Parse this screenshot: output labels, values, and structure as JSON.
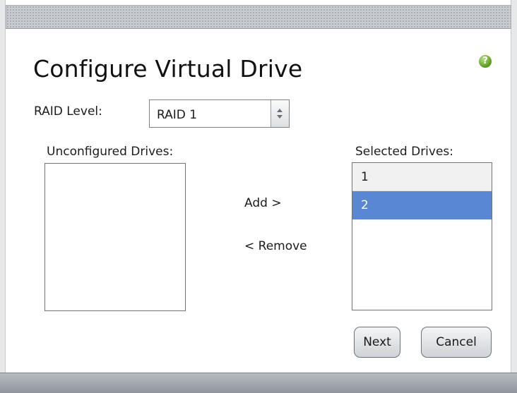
{
  "dialog": {
    "title": "Configure Virtual Drive",
    "help_icon": "help-question-icon",
    "help_glyph": "?"
  },
  "raid": {
    "label": "RAID Level:",
    "selected": "RAID 1"
  },
  "unconfigured": {
    "label": "Unconfigured Drives:",
    "items": []
  },
  "selected_drives": {
    "label": "Selected Drives:",
    "items": [
      "1",
      "2"
    ],
    "selected_index": 1
  },
  "actions": {
    "add": "Add >",
    "remove": "< Remove"
  },
  "buttons": {
    "next": "Next",
    "cancel": "Cancel"
  },
  "colors": {
    "selection": "#5a87d3",
    "help_green": "#5a9a22"
  }
}
